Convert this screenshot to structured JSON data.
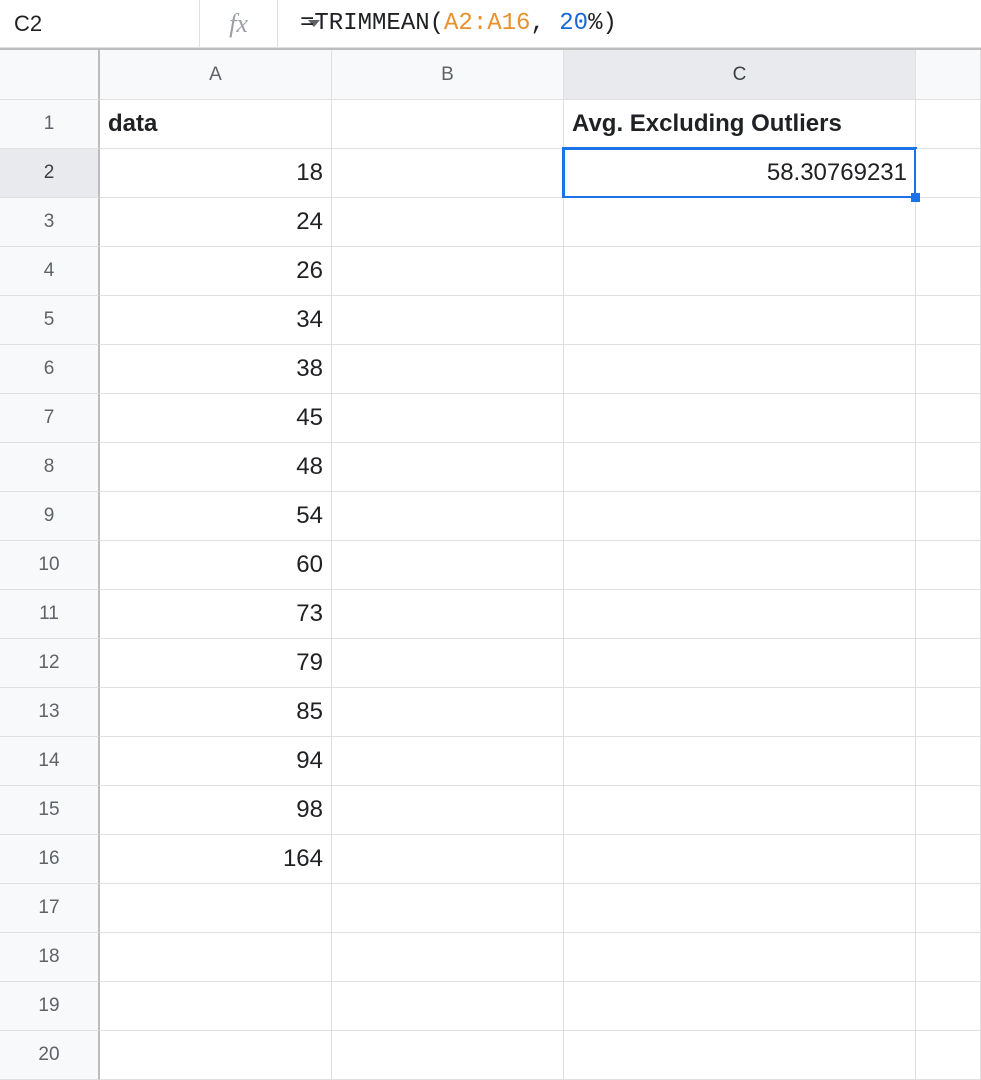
{
  "nameBox": "C2",
  "formula": {
    "prefix": "=",
    "fn": "TRIMMEAN",
    "open": "(",
    "range": "A2:A16",
    "comma": ", ",
    "num": "20",
    "pct": "%",
    "close": ")"
  },
  "columns": [
    "A",
    "B",
    "C",
    ""
  ],
  "rowCount": 20,
  "headers": {
    "A1": "data",
    "C1": "Avg. Excluding Outliers"
  },
  "colA": [
    "18",
    "24",
    "26",
    "34",
    "38",
    "45",
    "48",
    "54",
    "60",
    "73",
    "79",
    "85",
    "94",
    "98",
    "164"
  ],
  "C2": "58.30769231",
  "selected": {
    "col": "C",
    "row": 2
  }
}
